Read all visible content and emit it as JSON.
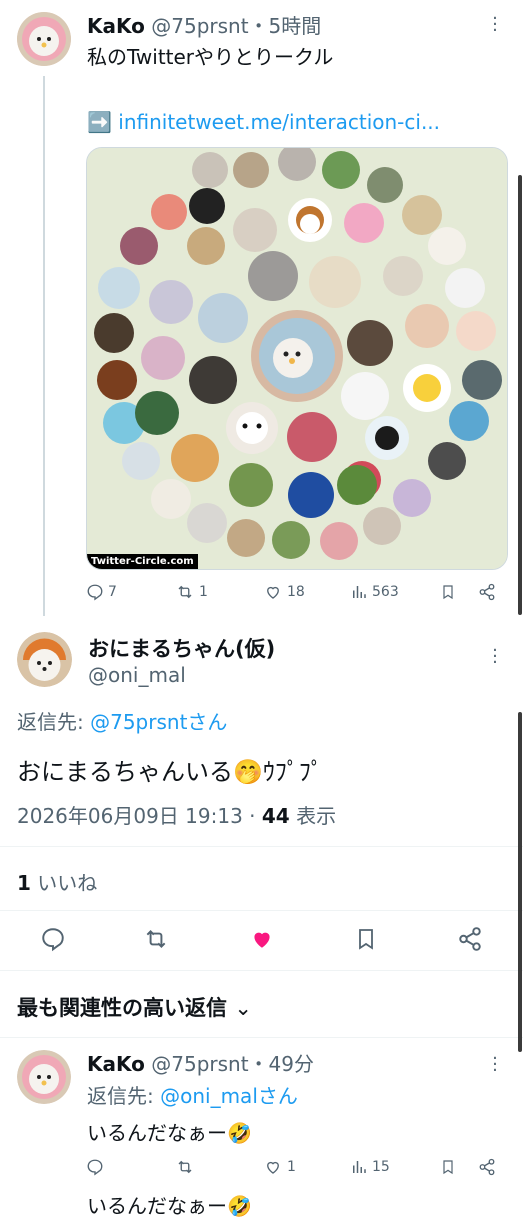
{
  "tweet1": {
    "display_name": "KaKo",
    "handle": "@75prsnt",
    "time": "・5時間",
    "text": "私のTwitterやりとりークル",
    "link_arrow": "➡️",
    "link_text": "infinitetweet.me/interaction-ci...",
    "image_watermark": "Twitter-Circle.com",
    "stats": {
      "replies": "7",
      "retweets": "1",
      "likes": "18",
      "views": "563"
    }
  },
  "tweet2": {
    "display_name": "おにまるちゃん(仮)",
    "handle": "@oni_mal",
    "reply_to_label": "返信先: ",
    "reply_to_handle": "@75prsntさん",
    "text": "おにまるちゃんいる🤭ｳﾌﾟﾌﾟ",
    "timestamp": "2026年06月09日 19:13",
    "views_sep": " · ",
    "views_count": "44",
    "views_label": " 表示",
    "likes_count": "1",
    "likes_label": " いいね"
  },
  "replies_header": {
    "label": "最も関連性の高い返信",
    "chevron": "⌄"
  },
  "tweet3": {
    "display_name": "KaKo",
    "handle": "@75prsnt",
    "time": "・49分",
    "reply_to_label": "返信先: ",
    "reply_to_handle": "@oni_malさん",
    "text": "いるんだなぁー🤣",
    "stats": {
      "replies": "",
      "retweets": "",
      "likes": "1",
      "views": "15"
    }
  },
  "tweet4_partial": {
    "text": "いるんだなぁー🤣"
  },
  "colors": {
    "accent": "#1d9bf0",
    "like_active": "#f91880",
    "muted": "#536471"
  }
}
